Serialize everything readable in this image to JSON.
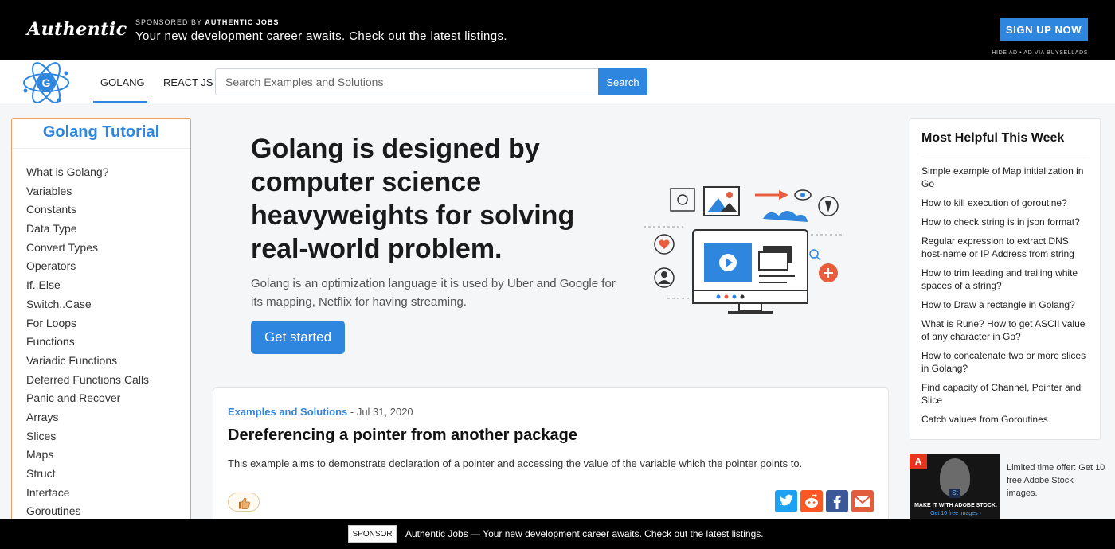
{
  "ad_top": {
    "logo": "Authentic",
    "sponsored_prefix": "SPONSORED BY ",
    "sponsored_by": "AUTHENTIC JOBS",
    "tagline": "Your new development career awaits. Check out the latest listings.",
    "cta": "SIGN UP NOW",
    "hide_ad": "HIDE AD • AD VIA BUYSELLADS"
  },
  "nav": {
    "tabs": [
      {
        "label": "GOLANG",
        "active": true
      },
      {
        "label": "REACT JS",
        "active": false
      }
    ],
    "search": {
      "placeholder": "Search Examples and Solutions",
      "button": "Search"
    }
  },
  "sidebar": {
    "title": "Golang Tutorial",
    "items": [
      "What is Golang?",
      "Variables",
      "Constants",
      "Data Type",
      "Convert Types",
      "Operators",
      "If..Else",
      "Switch..Case",
      "For Loops",
      "Functions",
      "Variadic Functions",
      "Deferred Functions Calls",
      "Panic and Recover",
      "Arrays",
      "Slices",
      "Maps",
      "Struct",
      "Interface",
      "Goroutines"
    ]
  },
  "hero": {
    "title": "Golang is designed by computer science heavyweights for solving real-world problem.",
    "subtitle": "Golang is an optimization language it is used by Uber and Google for its mapping, Netflix for having streaming.",
    "button": "Get started"
  },
  "post": {
    "category": "Examples and Solutions",
    "date": " - Jul 31, 2020",
    "title": "Dereferencing a pointer from another package",
    "excerpt": "This example aims to demonstrate declaration of a pointer and accessing the value of the variable which the pointer points to."
  },
  "helpful": {
    "title": "Most Helpful This Week",
    "items": [
      "Simple example of Map initialization in Go",
      "How to kill execution of goroutine?",
      "How to check string is in json format?",
      "Regular expression to extract DNS host-name or IP Address from string",
      "How to trim leading and trailing white spaces of a string?",
      "How to Draw a rectangle in Golang?",
      "What is Rune? How to get ASCII value of any character in Go?",
      "How to concatenate two or more slices in Golang?",
      "Find capacity of Channel, Pointer and Slice",
      "Catch values from Goroutines"
    ]
  },
  "side_ad": {
    "image_text": "MAKE IT WITH ADOBE STOCK.",
    "image_sub": "Get 10 free images ›",
    "text": "Limited time offer: Get 10 free Adobe Stock images."
  },
  "bottom_bar": {
    "sponsor_label": "SPONSOR",
    "text": "Authentic Jobs — Your new development career awaits. Check out the latest listings."
  },
  "colors": {
    "accent": "#2e86de",
    "sidebar_border": "#f0a060"
  }
}
